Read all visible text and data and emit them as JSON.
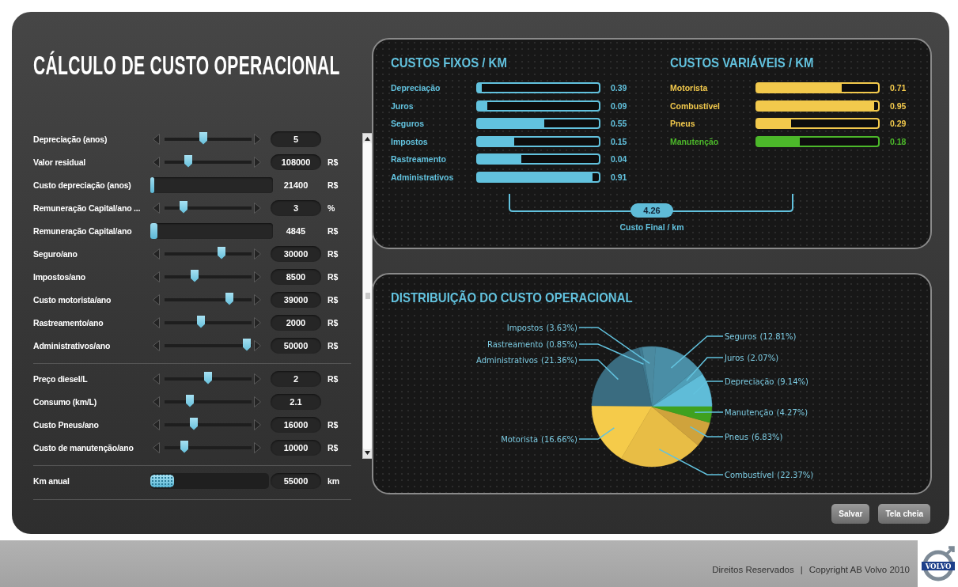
{
  "title": "CÁLCULO DE CUSTO OPERACIONAL",
  "parameter_groups": [
    {
      "rows": [
        {
          "label": "Depreciação (anos)",
          "kind": "slider",
          "level": 0.44,
          "value": "5"
        },
        {
          "label": "Valor residual",
          "kind": "slider",
          "level": 0.25,
          "value": "108000",
          "unit": "R$"
        },
        {
          "label": "Custo depreciação (anos)",
          "kind": "meter",
          "level": 0.02,
          "value": "21400",
          "unit": "R$"
        },
        {
          "label": "Remuneração Capital/ano ...",
          "kind": "slider",
          "level": 0.19,
          "value": "3",
          "unit": "%"
        },
        {
          "label": "Remuneração Capital/ano",
          "kind": "meter",
          "level": 0.06,
          "value": "4845",
          "unit": "R$"
        },
        {
          "label": "Seguro/ano",
          "kind": "slider",
          "level": 0.67,
          "value": "30000",
          "unit": "R$"
        },
        {
          "label": "Impostos/ano",
          "kind": "slider",
          "level": 0.33,
          "value": "8500",
          "unit": "R$"
        },
        {
          "label": "Custo motorista/ano",
          "kind": "slider",
          "level": 0.77,
          "value": "39000",
          "unit": "R$"
        },
        {
          "label": "Rastreamento/ano",
          "kind": "slider",
          "level": 0.41,
          "value": "2000",
          "unit": "R$"
        },
        {
          "label": "Administrativos/ano",
          "kind": "slider",
          "level": 0.99,
          "value": "50000",
          "unit": "R$"
        }
      ]
    },
    {
      "rows": [
        {
          "label": "Preço diesel/L",
          "kind": "slider",
          "level": 0.5,
          "value": "2",
          "unit": "R$"
        },
        {
          "label": "Consumo (km/L)",
          "kind": "slider",
          "level": 0.27,
          "value": "2.1"
        },
        {
          "label": "Custo Pneus/ano",
          "kind": "slider",
          "level": 0.32,
          "value": "16000",
          "unit": "R$"
        },
        {
          "label": "Custo de manutenção/ano",
          "kind": "slider",
          "level": 0.2,
          "value": "10000",
          "unit": "R$"
        }
      ]
    },
    {
      "rows": [
        {
          "label": "Km anual",
          "kind": "range",
          "level": 0,
          "value": "55000",
          "unit": "km"
        }
      ]
    }
  ],
  "fixed_costs": {
    "heading": "CUSTOS FIXOS / KM",
    "items": [
      {
        "label": "Depreciação",
        "level": 0.03,
        "value": "0.39"
      },
      {
        "label": "Juros",
        "level": 0.08,
        "value": "0.09"
      },
      {
        "label": "Seguros",
        "level": 0.55,
        "value": "0.55"
      },
      {
        "label": "Impostos",
        "level": 0.3,
        "value": "0.15"
      },
      {
        "label": "Rastreamento",
        "level": 0.36,
        "value": "0.04"
      },
      {
        "label": "Administrativos",
        "level": 0.95,
        "value": "0.91"
      }
    ]
  },
  "variable_costs": {
    "heading": "CUSTOS VARIÁVEIS / KM",
    "items": [
      {
        "label": "Motorista",
        "level": 0.7,
        "value": "0.71",
        "color": "#f2c94c"
      },
      {
        "label": "Combustível",
        "level": 0.97,
        "value": "0.95",
        "color": "#f2c94c"
      },
      {
        "label": "Pneus",
        "level": 0.28,
        "value": "0.29",
        "color": "#f2c94c"
      },
      {
        "label": "Manutenção",
        "level": 0.35,
        "value": "0.18",
        "color": "#4cb82a"
      }
    ]
  },
  "total": {
    "value": "4.26",
    "label": "Custo Final / km"
  },
  "distribution": {
    "title": "DISTRIBUIÇÃO DO CUSTO OPERACIONAL",
    "chart_data": {
      "type": "pie",
      "categories": [
        "Depreciação",
        "Juros",
        "Seguros",
        "Impostos",
        "Rastreamento",
        "Administrativos",
        "Motorista",
        "Combustível",
        "Pneus",
        "Manutenção"
      ],
      "values": [
        9.14,
        2.07,
        12.81,
        3.63,
        0.85,
        21.36,
        16.66,
        22.37,
        6.83,
        4.27
      ],
      "colors": [
        "#5fbcd8",
        "#4f9fb8",
        "#4a8ea6",
        "#4b8aa0",
        "#3f7a90",
        "#3a6c80",
        "#f5cb4a",
        "#e8bd45",
        "#cfa33c",
        "#3fa11f"
      ],
      "value_labels": [
        "(9.14%)",
        "(2.07%)",
        "(12.81%)",
        "(3.63%)",
        "(0.85%)",
        "(21.36%)",
        "(16.66%)",
        "(22.37%)",
        "(6.83%)",
        "(4.27%)"
      ]
    }
  },
  "buttons": [
    "Salvar",
    "Tela cheia"
  ],
  "footer": {
    "rights": "Direitos Reservados",
    "separator": "|",
    "copyright": "Copyright AB Volvo 2010",
    "logo_text": "VOLVO"
  }
}
